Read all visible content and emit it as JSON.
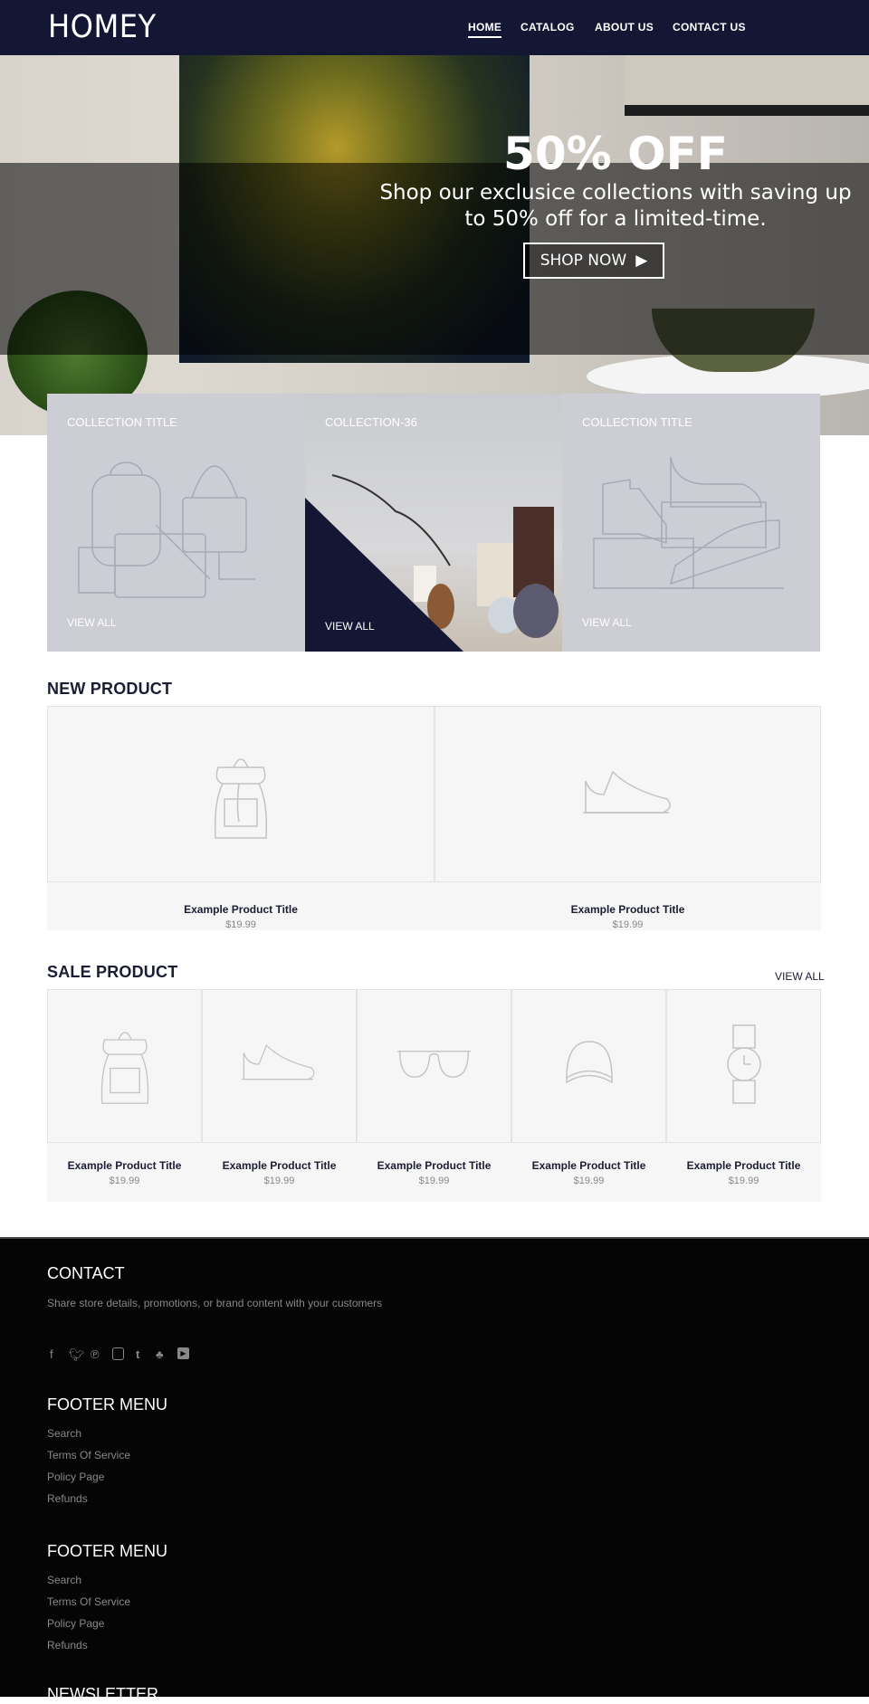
{
  "nav": {
    "logo": "HOMEY",
    "links": [
      {
        "label": "HOME",
        "active": true
      },
      {
        "label": "CATALOG"
      },
      {
        "label": "ABOUT US"
      },
      {
        "label": "CONTACT US"
      }
    ]
  },
  "hero": {
    "title": "50% OFF",
    "subtitle": "Shop our exclusice collections with saving up to 50% off for a limited-time.",
    "button": "SHOP NOW",
    "button_icon": "play-triangle-icon"
  },
  "collections": [
    {
      "title": "COLLECTION TITLE",
      "link": "VIEW ALL",
      "icon": "bags-icon"
    },
    {
      "title": "COLLECTION-36",
      "link": "VIEW ALL",
      "accent": "#141733"
    },
    {
      "title": "COLLECTION TITLE",
      "link": "VIEW ALL",
      "icon": "shoes-icon"
    }
  ],
  "new_product": {
    "heading": "NEW PRODUCT",
    "items": [
      {
        "title": "Example Product Title",
        "price": "$19.99",
        "icon": "backpack-icon"
      },
      {
        "title": "Example Product Title",
        "price": "$19.99",
        "icon": "sneaker-icon"
      }
    ]
  },
  "sale_product": {
    "heading": "SALE PRODUCT",
    "view_all": "VIEW ALL",
    "items": [
      {
        "title": "Example Product Title",
        "price": "$19.99",
        "icon": "backpack-icon"
      },
      {
        "title": "Example Product Title",
        "price": "$19.99",
        "icon": "sneaker-icon"
      },
      {
        "title": "Example Product Title",
        "price": "$19.99",
        "icon": "sunglasses-icon"
      },
      {
        "title": "Example Product Title",
        "price": "$19.99",
        "icon": "cap-icon"
      },
      {
        "title": "Example Product Title",
        "price": "$19.99",
        "icon": "watch-icon"
      }
    ]
  },
  "footer": {
    "contact_heading": "CONTACT",
    "contact_text": "Share store details, promotions, or brand content with your customers",
    "social": [
      "facebook-icon",
      "twitter-icon",
      "pinterest-icon",
      "instagram-icon",
      "tumblr-icon",
      "snapchat-icon",
      "youtube-icon"
    ],
    "menus": [
      {
        "heading": "FOOTER MENU",
        "links": [
          "Search",
          "Terms Of Service",
          "Policy Page",
          "Refunds"
        ]
      },
      {
        "heading": "FOOTER MENU",
        "links": [
          "Search",
          "Terms Of Service",
          "Policy Page",
          "Refunds"
        ]
      }
    ],
    "newsletter_heading": "NEWSLETTER"
  },
  "colors": {
    "nav_bg": "#141733",
    "accent": "#141733",
    "collection_bg": "#cdcdd6",
    "footer_bg": "#050505"
  }
}
